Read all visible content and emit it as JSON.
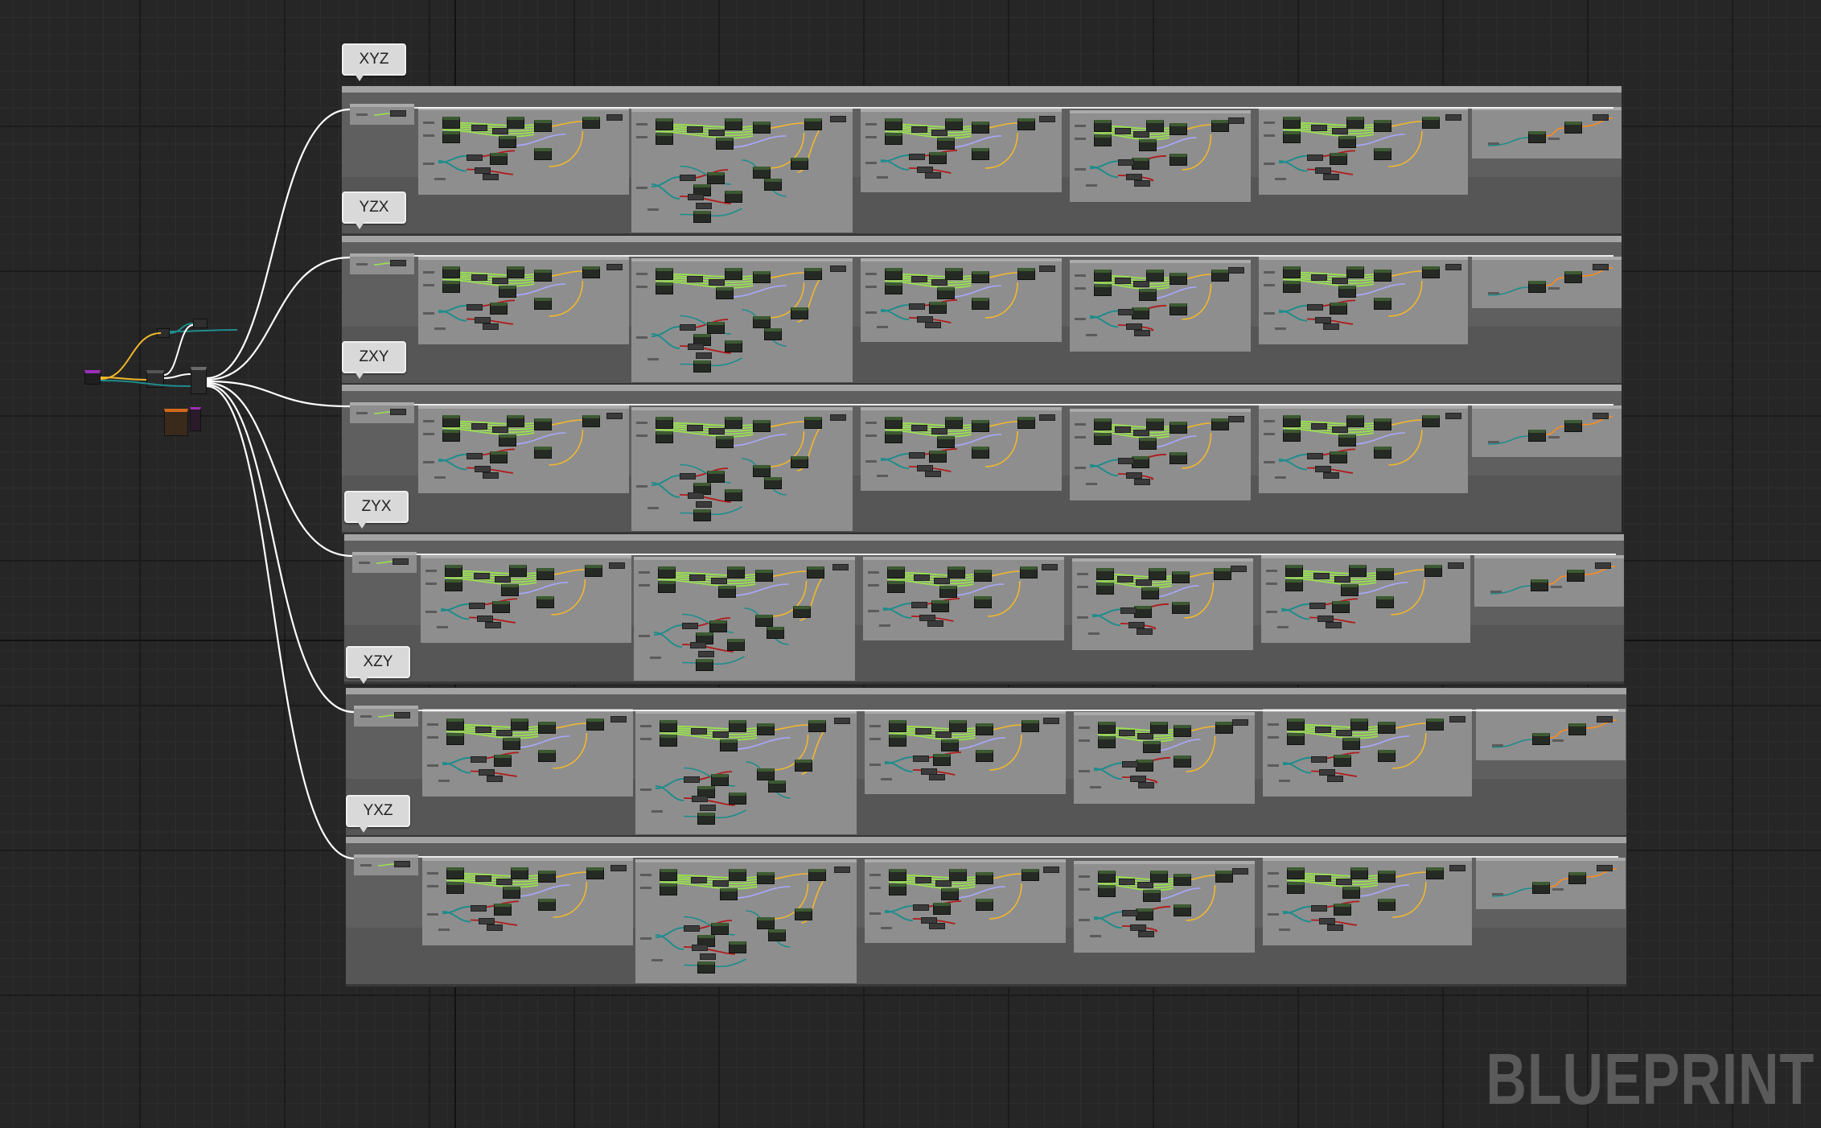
{
  "canvas": {
    "background": "#262626",
    "watermark": "BLUEPRINT"
  },
  "groups": [
    {
      "comment": "XYZ"
    },
    {
      "comment": "YZX"
    },
    {
      "comment": "ZXY"
    },
    {
      "comment": "ZYX"
    },
    {
      "comment": "XZY"
    },
    {
      "comment": "YXZ"
    }
  ],
  "colors": {
    "exec_wire": "#ffffff",
    "float_wire": "#9ae34d",
    "vector_wire": "#f2b82b",
    "rotator_wire": "#a8a8ff",
    "bool_wire": "#b01a1a",
    "struct_wire": "#1f8c8c",
    "object_wire": "#ff8c1a",
    "actor_pin": "#b347c9"
  }
}
